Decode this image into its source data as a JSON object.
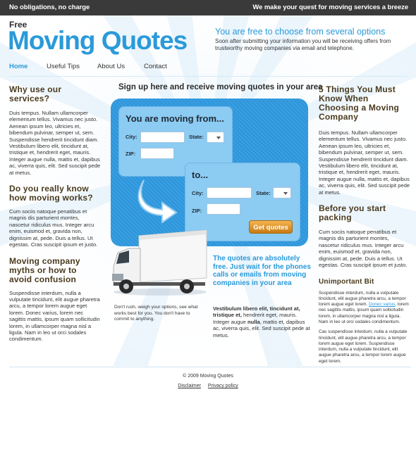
{
  "topbar": {
    "left_text": "No obligations, no charge",
    "right_text": "We make your quest for moving services a breeze"
  },
  "logo": {
    "small": "Free",
    "main": "Moving Quotes"
  },
  "header": {
    "heading": "You are free to choose from several options",
    "text": "Soon after submitting your information you will be receiving offers from trustworthy moving companies via email and telephone."
  },
  "nav": {
    "items": [
      "Home",
      "Useful Tips",
      "About Us",
      "Contact"
    ],
    "active": "Home"
  },
  "left": {
    "s1_title": "Why use our services?",
    "s1_text": "Duis tempus. Nullam ullamcorper elementum tellus. Vivamus nec justo. Aenean ipsum leo, ultricies et, bibendum pulvinar, semper ut, sem. Suspendisse hendrerit tincidunt diam. Vestibulum libero elit, tincidunt at, tristique et, hendrerit eget, mauris. Integer augue nulla, mattis et, dapibus ac, viverra quis, elit. Sed suscipit pede at metus.",
    "s2_title": "Do you really know how moving works?",
    "s2_text": "Cum sociis natoque penatibus et magnis dis parturient montes, nascetur ridiculus mus. Integer arcu enim, euismod et, gravida non, dignissim at, pede. Duis a tellus. Ut egestas. Cras suscipit ipsum et justo.",
    "s3_title": "Moving company myths or how to avoid confusion",
    "s3_text": "Suspendisse interdum, nulla a vulputate tincidunt, elit augue pharetra arcu, a tempor lorem augue eget lorem. Donec varius, lorem nec sagittis mattis, ipsum quam sollicitudin lorem, in ullamcorper magna nisl a ligula. Nam in leo ut orci sodales condimentum."
  },
  "center": {
    "title": "Sign up here and receive moving quotes in your area",
    "from_heading": "You are moving from...",
    "to_heading": "to...",
    "city_label": "City:",
    "state_label": "State:",
    "zip_label": "ZIP:",
    "button": "Get quotes",
    "caption": "Don't rush, weigh your options, see what works best for you. You don't have to commit to anything.",
    "blue_heading": "The quotes are absolutely free. Just wait for the phones calls or emails from moving companies in your area",
    "bold_intro": "Vestibulum libero elit, tincidunt at, tristique et,",
    "text_a": " hendrerit eget, mauris. Integer augue ",
    "text_bold": "nulla",
    "text_b": ", mattis et, dapibus ac, viverra quis, elit. Sed suscipit pede at metus."
  },
  "right": {
    "s1_title": "5 Things You Must Know When Choosing a Moving Company",
    "s1_text": "Duis tempus. Nullam ullamcorper elementum tellus. Vivamus nec justo. Aenean ipsum leo, ultricies et, bibendum pulvinar, semper ut, sem. Suspendisse hendrerit tincidunt diam. Vestibulum libero elit, tincidunt at, tristique et, hendrerit eget, mauris. Integer augue nulla, mattis et, dapibus ac, viverra quis, elit. Sed suscipit pede at metus.",
    "s2_title": "Before you start packing",
    "s2_text": "Cum sociis natoque penatibus et magnis dis parturient montes, nascetur ridiculus mus. Integer arcu enim, euismod et, gravida non, dignissim at, pede. Duis a tellus. Ut egestas. Cras suscipit ipsum et justo.",
    "s3_title": "Unimportant Bit",
    "s3_text_a": "Suspendisse interdum, nulla a vulputate tincidunt, elit augue pharetra arcu, a tempor lorem augue eget lorem. ",
    "s3_link": "Donec varius",
    "s3_text_b": ", lorem nec sagittis mattis, ipsum quam sollicitudin lorem, in ullamcorper magna nisl a ligula. Nam in leo ut orci sodales condimentum.",
    "s3_text2": "Cas suspendisse interdum, nulla a vulputate tincidunt, elit augue pharetra arcu, a tempor lorem augue eget lorem. Suspendisse interdum, nulla a vulputate tincidunt, elit augue pharetra arcu, a tempor lorem augue eget lorem."
  },
  "footer": {
    "copyright": "© 2009 Moving Quotes",
    "links": [
      "Disclaimer",
      "Privacy policy"
    ]
  },
  "colors": {
    "accent": "#2a9ad9",
    "heading": "#4a3a1e",
    "topbar": "#3a3a3a",
    "button": "#e39a2a"
  }
}
